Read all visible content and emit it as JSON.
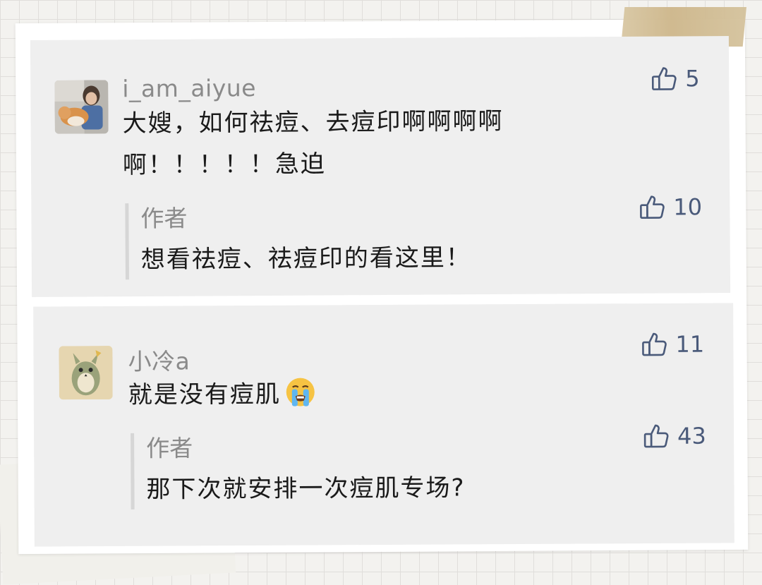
{
  "comments": [
    {
      "username": "i_am_aiyue",
      "text_line1": "大嫂，如何祛痘、去痘印啊啊啊啊",
      "text_line2": "啊！！！！！急迫",
      "likes": "5",
      "reply": {
        "author": "作者",
        "text": "想看祛痘、祛痘印的看这里！",
        "likes": "10"
      }
    },
    {
      "username": "小冷a",
      "text": "就是没有痘肌",
      "emoji": "loudly-crying-face",
      "likes": "11",
      "reply": {
        "author": "作者",
        "text": "那下次就安排一次痘肌专场?",
        "likes": "43"
      }
    }
  ],
  "colors": {
    "card_bg": "#efefef",
    "username": "#8a8a8a",
    "text": "#1a1a1a",
    "like": "#4a5a7a",
    "reply_bar": "#d6d6d6",
    "tape": "#cdb68a"
  },
  "icons": {
    "like": "thumbs-up-icon"
  }
}
